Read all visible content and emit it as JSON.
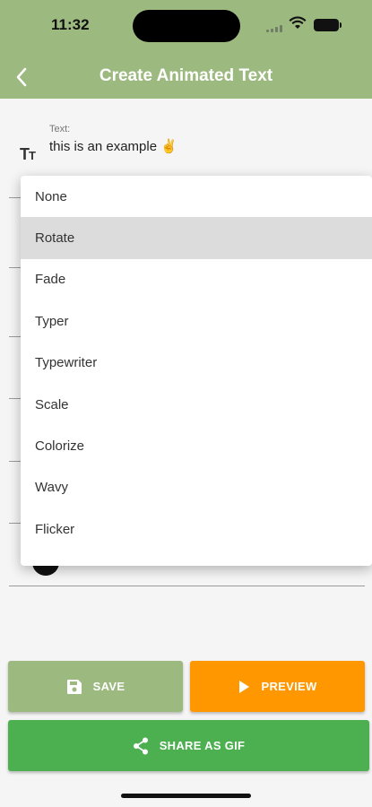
{
  "status_bar": {
    "time": "11:32"
  },
  "app_bar": {
    "title": "Create Animated Text",
    "back_icon": "chevron-left-icon"
  },
  "text_field": {
    "label": "Text:",
    "value": "this is an example ✌️",
    "icon": "text-size-icon"
  },
  "animation_menu": {
    "selected": "Rotate",
    "items": [
      "None",
      "Rotate",
      "Fade",
      "Typer",
      "Typewriter",
      "Scale",
      "Colorize",
      "Wavy",
      "Flicker"
    ]
  },
  "actions": {
    "save_label": "SAVE",
    "preview_label": "PREVIEW",
    "share_label": "SHARE AS GIF"
  },
  "colors": {
    "app_bar": "#9cb97f",
    "save": "#9cb97f",
    "preview": "#ff9800",
    "share": "#4caf50",
    "menu_selected": "#dcdcdc"
  }
}
